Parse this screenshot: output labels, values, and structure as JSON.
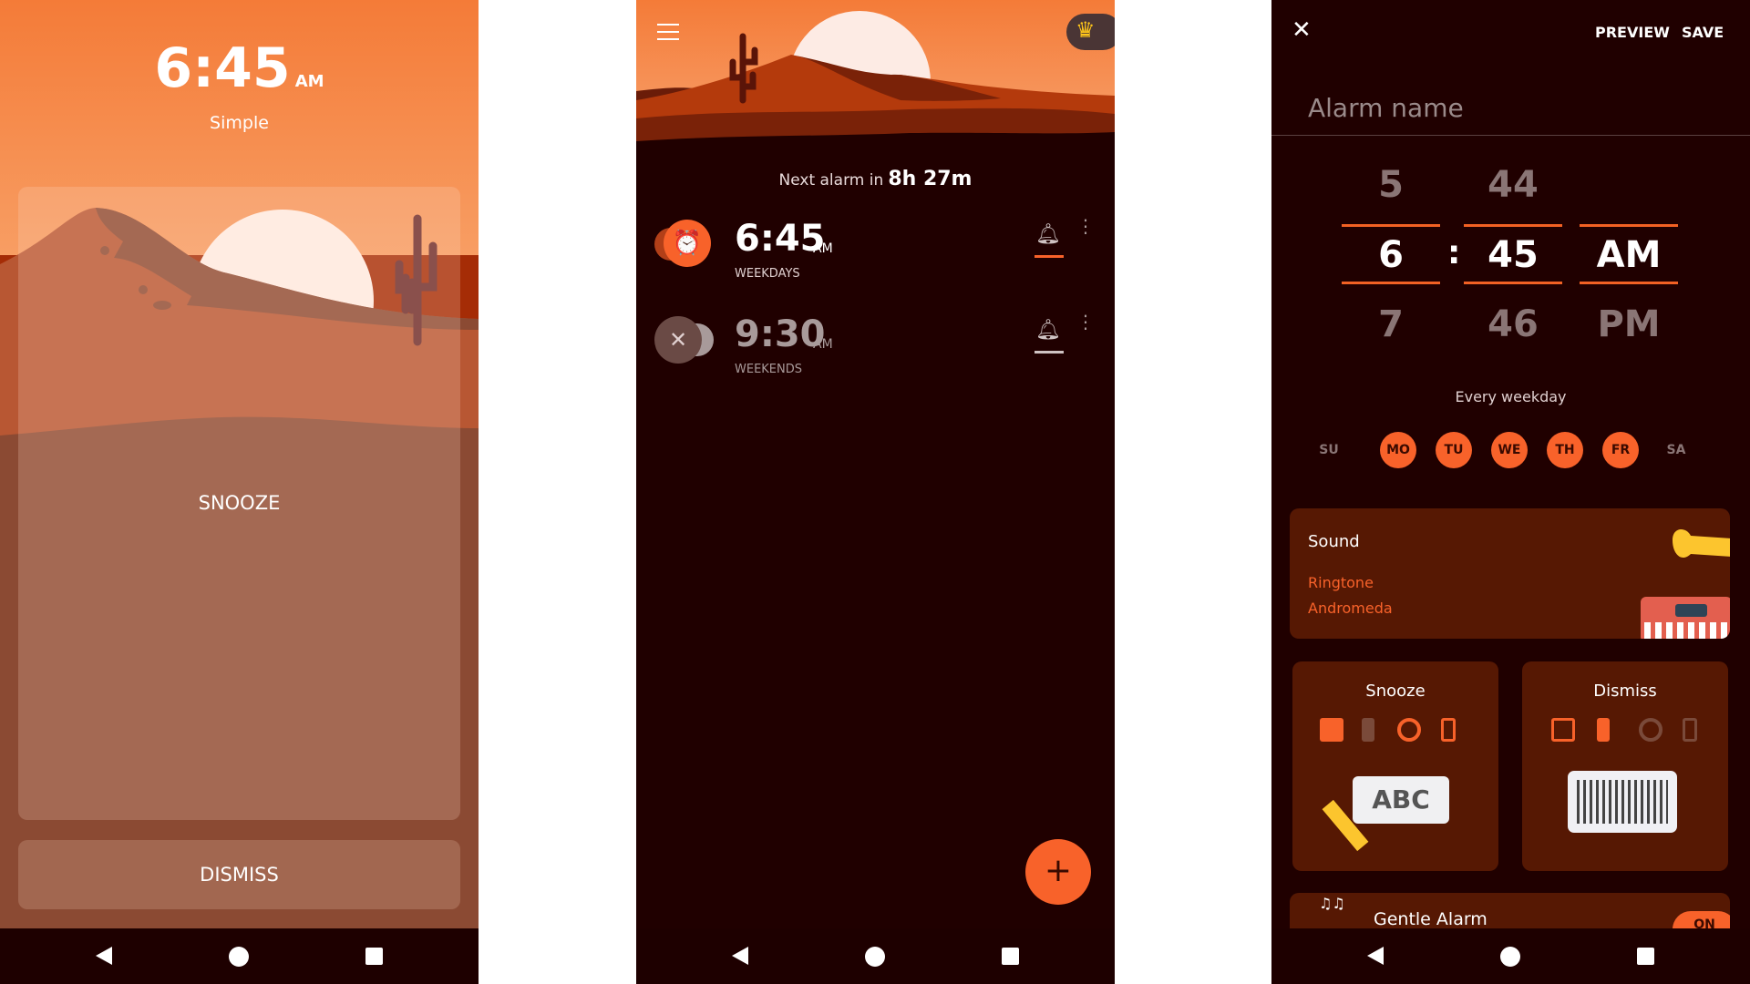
{
  "ringing_screen": {
    "time": "6:45",
    "ampm": "AM",
    "label": "Simple",
    "snooze_label": "SNOOZE",
    "dismiss_label": "DISMISS"
  },
  "alarm_list": {
    "next_alarm_prefix": "Next alarm in",
    "next_alarm_value": "8h 27m",
    "alarms": [
      {
        "time": "6:45",
        "ampm": "AM",
        "repeat": "WEEKDAYS",
        "enabled": true
      },
      {
        "time": "9:30",
        "ampm": "AM",
        "repeat": "WEEKENDS",
        "enabled": false
      }
    ],
    "add_label": "+"
  },
  "editor": {
    "preview_label": "PREVIEW",
    "save_label": "SAVE",
    "alarm_name_placeholder": "Alarm name",
    "picker": {
      "hours": [
        "5",
        "6",
        "7"
      ],
      "separator": ":",
      "minutes": [
        "44",
        "45",
        "46"
      ],
      "ampm": [
        "AM",
        "PM"
      ]
    },
    "repeat_summary": "Every weekday",
    "days": [
      {
        "label": "SU",
        "selected": false
      },
      {
        "label": "MO",
        "selected": true
      },
      {
        "label": "TU",
        "selected": true
      },
      {
        "label": "WE",
        "selected": true
      },
      {
        "label": "TH",
        "selected": true
      },
      {
        "label": "FR",
        "selected": true
      },
      {
        "label": "SA",
        "selected": false
      }
    ],
    "sound": {
      "title": "Sound",
      "type": "Ringtone",
      "name": "Andromeda"
    },
    "snooze": {
      "title": "Snooze",
      "puzzle_text": "ABC"
    },
    "dismiss": {
      "title": "Dismiss"
    },
    "gentle_alarm": {
      "title": "Gentle Alarm",
      "toggle": "ON"
    }
  },
  "colors": {
    "accent": "#f8622a",
    "background": "#200000",
    "card": "#561803",
    "sky": "#f47b38"
  }
}
